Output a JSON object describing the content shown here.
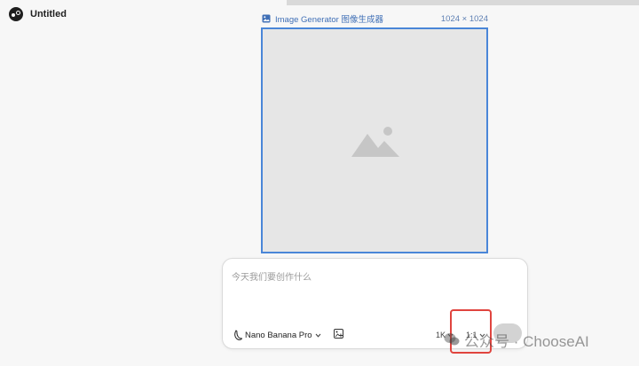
{
  "document": {
    "title": "Untitled"
  },
  "node": {
    "title": "Image Generator  图像生成器",
    "size_label": "1024 × 1024",
    "icon": "image-icon",
    "placeholder_icon": "mountain-image-placeholder-icon"
  },
  "prompt": {
    "placeholder": "今天我们要创作什么",
    "model_label": "Nano Banana Pro",
    "model_icon": "banana-icon",
    "reference_icon": "add-image-icon",
    "resolution_label": "1K",
    "ratio_label": "1:1"
  },
  "watermark": {
    "text": "公众号 · ChooseAI",
    "icon": "wechat-icon"
  },
  "colors": {
    "accent": "#4a86d8",
    "highlight": "#e0443e",
    "canvas_bg": "#f7f7f7",
    "placeholder_bg": "#e6e6e6"
  }
}
